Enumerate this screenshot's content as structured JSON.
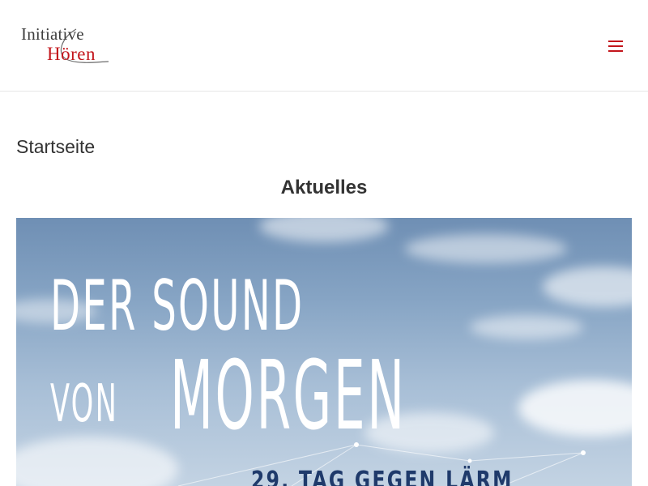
{
  "header": {
    "logo": {
      "line1": "Initiative",
      "line2": "Hören"
    },
    "menu_icon": "hamburger-menu-icon",
    "accent_color": "#c3161c"
  },
  "breadcrumb": "Startseite",
  "section_title": "Aktuelles",
  "banner": {
    "headline_line1": "DER SOUND",
    "headline_line2_small": "VON",
    "headline_line2_large": "MORGEN",
    "subline": "29. TAG GEGEN LÄRM",
    "text_color": "#ffffff",
    "subline_color": "#1f3a6b"
  }
}
